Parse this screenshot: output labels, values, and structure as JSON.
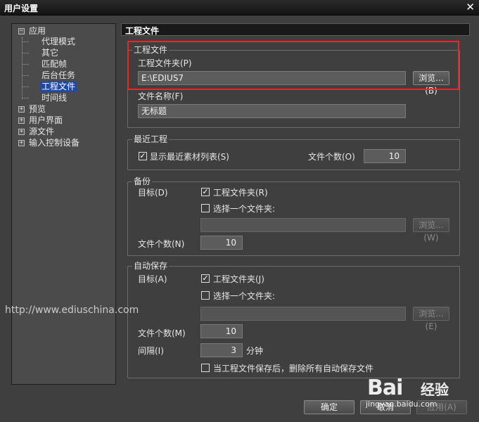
{
  "window": {
    "title": "用户设置",
    "close_glyph": "✕"
  },
  "tree": {
    "app": "应用",
    "app_children": [
      "代理模式",
      "其它",
      "匹配帧",
      "后台任务",
      "工程文件",
      "时间线"
    ],
    "others": [
      "预览",
      "用户界面",
      "源文件",
      "输入控制设备"
    ],
    "expanded_glyph": "−",
    "collapsed_glyph": "+"
  },
  "panel": {
    "title": "工程文件"
  },
  "project_file": {
    "legend": "工程文件",
    "folder_label": "工程文件夹(P)",
    "folder_value": "E:\\EDIUS7",
    "browse": "浏览...(B)",
    "filename_label": "文件名称(F)",
    "filename_value": "无标题"
  },
  "recent": {
    "legend": "最近工程",
    "show_list_label": "显示最近素材列表(S)",
    "count_label": "文件个数(O)",
    "count_value": "10"
  },
  "backup": {
    "legend": "备份",
    "target_label": "目标(D)",
    "project_folder": "工程文件夹(R)",
    "choose_folder": "选择一个文件夹:",
    "browse": "浏览...(W)",
    "count_label": "文件个数(N)",
    "count_value": "10"
  },
  "autosave": {
    "legend": "自动保存",
    "target_label": "目标(A)",
    "project_folder": "工程文件夹(J)",
    "choose_folder": "选择一个文件夹:",
    "browse": "浏览...(E)",
    "count_label": "文件个数(M)",
    "count_value": "10",
    "interval_label": "间隔(I)",
    "interval_value": "3",
    "interval_unit": "分钟",
    "delete_label": "当工程文件保存后，删除所有自动保存文件"
  },
  "buttons": {
    "ok": "确定",
    "cancel": "取消",
    "apply": "应用(A)"
  },
  "watermarks": {
    "site": "http://www.ediuschina.com",
    "baidu": "Bai",
    "baidu2": "经验",
    "baidu_url": "jingyan.baidu.com"
  },
  "check": "✓",
  "colors": {
    "highlight": "#e8262b",
    "selection": "#1f4aa8"
  }
}
